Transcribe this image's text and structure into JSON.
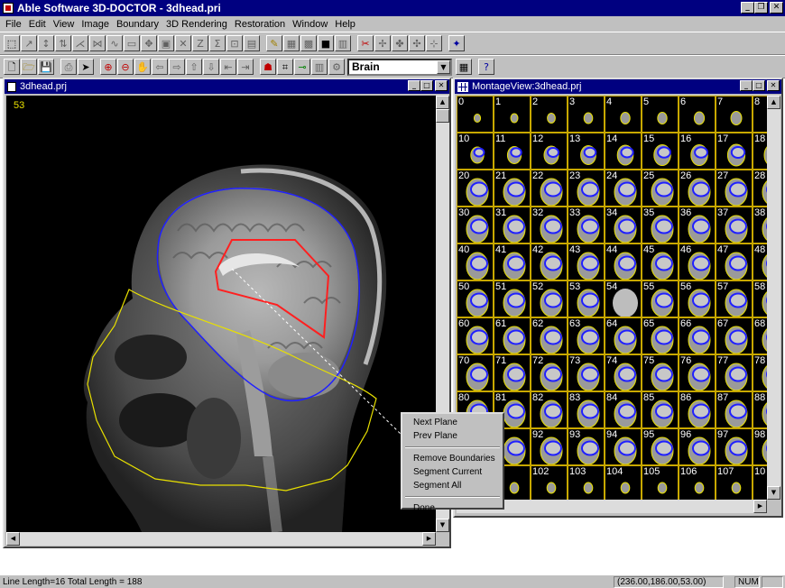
{
  "app": {
    "title": "Able Software 3D-DOCTOR - 3dhead.pri"
  },
  "menu": [
    "File",
    "Edit",
    "View",
    "Image",
    "Boundary",
    "3D Rendering",
    "Restoration",
    "Window",
    "Help"
  ],
  "toolbar": {
    "object_select": "Brain"
  },
  "image_window": {
    "title": "3dhead.prj",
    "slice_number": "53"
  },
  "montage_window": {
    "title": "MontageView:3dhead.prj",
    "slices": [
      "0",
      "1",
      "2",
      "3",
      "4",
      "5",
      "6",
      "7",
      "8",
      "10",
      "11",
      "12",
      "13",
      "14",
      "15",
      "16",
      "17",
      "18",
      "20",
      "21",
      "22",
      "23",
      "24",
      "25",
      "26",
      "27",
      "28",
      "30",
      "31",
      "32",
      "33",
      "34",
      "35",
      "36",
      "37",
      "38",
      "40",
      "41",
      "42",
      "43",
      "44",
      "45",
      "46",
      "47",
      "48",
      "50",
      "51",
      "52",
      "53",
      "54",
      "55",
      "56",
      "57",
      "58",
      "60",
      "61",
      "62",
      "63",
      "64",
      "65",
      "66",
      "67",
      "68",
      "70",
      "71",
      "72",
      "73",
      "74",
      "75",
      "76",
      "77",
      "78",
      "80",
      "81",
      "82",
      "83",
      "84",
      "85",
      "86",
      "87",
      "88",
      "",
      "",
      "92",
      "93",
      "94",
      "95",
      "96",
      "97",
      "98",
      "",
      "1",
      "102",
      "103",
      "104",
      "105",
      "106",
      "107",
      "10"
    ]
  },
  "context_menu": {
    "next_plane": "Next Plane",
    "prev_plane": "Prev Plane",
    "remove_boundaries": "Remove Boundaries",
    "segment_current": "Segment Current",
    "segment_all": "Segment All",
    "done": "Done"
  },
  "status": {
    "message": "Line Length=16 Total Length = 188",
    "coords": "(236.00,186.00,53.00)",
    "num": "NUM"
  },
  "colors": {
    "titlebar": "#000080",
    "boundary_blue": "#2020ff",
    "boundary_red": "#ff2020",
    "trace_yellow": "#e8e000"
  }
}
